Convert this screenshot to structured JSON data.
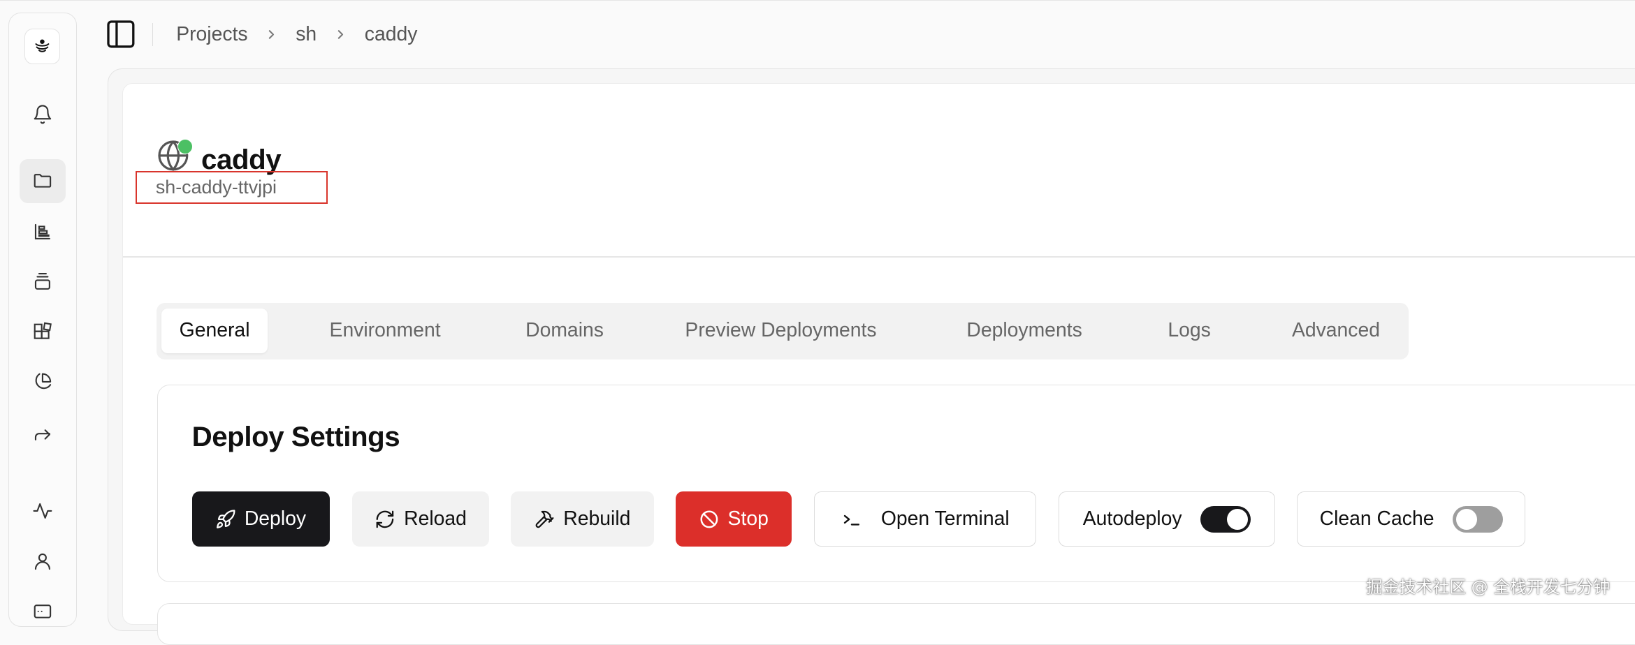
{
  "breadcrumb": {
    "items": [
      "Projects",
      "sh",
      "caddy"
    ]
  },
  "app": {
    "name": "caddy",
    "id": "sh-caddy-ttvjpi",
    "status_color": "#4cc064"
  },
  "tabs": [
    "General",
    "Environment",
    "Domains",
    "Preview Deployments",
    "Deployments",
    "Logs",
    "Advanced"
  ],
  "deploy_settings": {
    "title": "Deploy Settings",
    "deploy": "Deploy",
    "reload": "Reload",
    "rebuild": "Rebuild",
    "stop": "Stop",
    "open_terminal": "Open Terminal",
    "autodeploy": "Autodeploy",
    "autodeploy_on": true,
    "clean_cache": "Clean Cache",
    "clean_cache_on": false
  },
  "watermark": "掘金技术社区 @ 全栈开发七分钟",
  "colors": {
    "stop": "#dc2f2a",
    "dark": "#18181b",
    "highlight": "#d9352c"
  }
}
